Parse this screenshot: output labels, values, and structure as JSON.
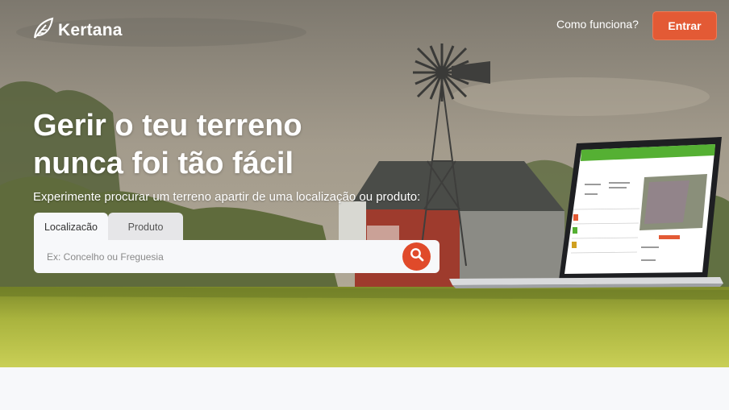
{
  "header": {
    "logo_text": "Kertana",
    "nav_how": "Como funciona?",
    "login_label": "Entrar"
  },
  "hero": {
    "title_line1": "Gerir o teu terreno",
    "title_line2": "nunca foi tão fácil",
    "subtitle": "Experimente procurar um terreno apartir de uma localização ou produto:"
  },
  "search": {
    "tabs": [
      {
        "label": "Localizacão",
        "active": true
      },
      {
        "label": "Produto",
        "active": false
      }
    ],
    "placeholder": "Ex: Concelho ou Freguesia"
  },
  "colors": {
    "accent": "#e35a35",
    "search_button": "#e04a2a",
    "app_green": "#55b033"
  },
  "icons": {
    "logo": "leaf-icon",
    "search": "search-icon"
  }
}
